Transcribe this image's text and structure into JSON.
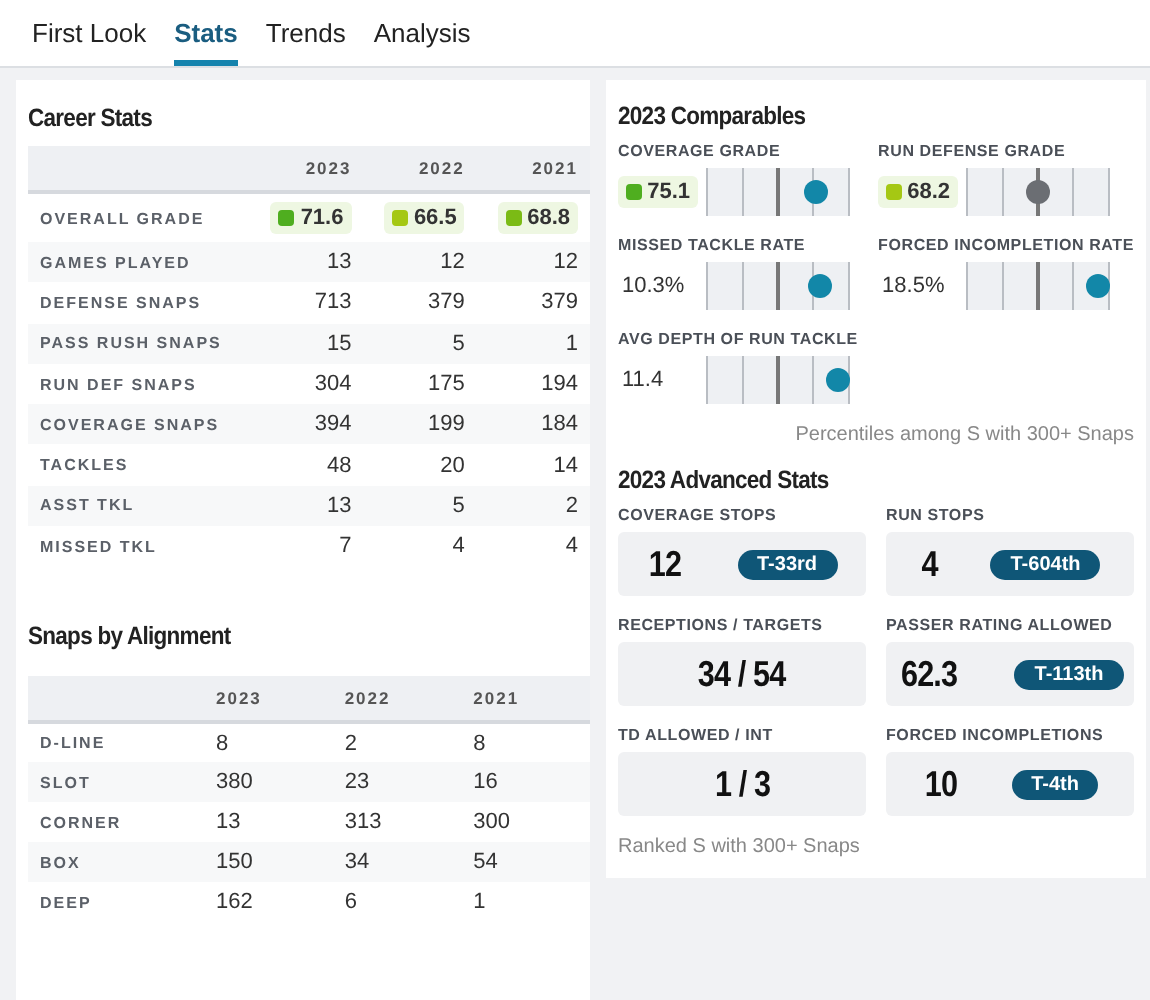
{
  "tabs": [
    {
      "label": "First Look",
      "selected": false
    },
    {
      "label": "Stats",
      "selected": true
    },
    {
      "label": "Trends",
      "selected": false
    },
    {
      "label": "Analysis",
      "selected": false
    }
  ],
  "career_stats": {
    "title": "Career Stats",
    "columns": [
      "2023",
      "2022",
      "2021"
    ],
    "rows": [
      {
        "label": "OVERALL GRADE",
        "kind": "grade",
        "cells": [
          {
            "value": "71.6",
            "color": "#4fae1f"
          },
          {
            "value": "66.5",
            "color": "#a5c813"
          },
          {
            "value": "68.8",
            "color": "#7bbb15"
          }
        ]
      },
      {
        "label": "GAMES PLAYED",
        "kind": "plain",
        "cells": [
          {
            "value": "13"
          },
          {
            "value": "12"
          },
          {
            "value": "12"
          }
        ]
      },
      {
        "label": "DEFENSE SNAPS",
        "kind": "plain",
        "cells": [
          {
            "value": "713"
          },
          {
            "value": "379"
          },
          {
            "value": "379"
          }
        ]
      },
      {
        "label": "PASS RUSH SNAPS",
        "kind": "plain",
        "cells": [
          {
            "value": "15"
          },
          {
            "value": "5"
          },
          {
            "value": "1"
          }
        ]
      },
      {
        "label": "RUN DEF SNAPS",
        "kind": "plain",
        "cells": [
          {
            "value": "304"
          },
          {
            "value": "175"
          },
          {
            "value": "194"
          }
        ]
      },
      {
        "label": "COVERAGE SNAPS",
        "kind": "plain",
        "cells": [
          {
            "value": "394"
          },
          {
            "value": "199"
          },
          {
            "value": "184"
          }
        ]
      },
      {
        "label": "TACKLES",
        "kind": "plain",
        "cells": [
          {
            "value": "48"
          },
          {
            "value": "20"
          },
          {
            "value": "14"
          }
        ]
      },
      {
        "label": "ASST TKL",
        "kind": "plain",
        "cells": [
          {
            "value": "13"
          },
          {
            "value": "5"
          },
          {
            "value": "2"
          }
        ]
      },
      {
        "label": "MISSED TKL",
        "kind": "plain",
        "cells": [
          {
            "value": "7"
          },
          {
            "value": "4"
          },
          {
            "value": "4"
          }
        ]
      }
    ]
  },
  "snaps_by_alignment": {
    "title": "Snaps by Alignment",
    "columns": [
      "2023",
      "2022",
      "2021"
    ],
    "rows": [
      {
        "label": "D-LINE",
        "cells": [
          "8",
          "2",
          "8"
        ]
      },
      {
        "label": "SLOT",
        "cells": [
          "380",
          "23",
          "16"
        ]
      },
      {
        "label": "CORNER",
        "cells": [
          "13",
          "313",
          "300"
        ]
      },
      {
        "label": "BOX",
        "cells": [
          "150",
          "34",
          "54"
        ]
      },
      {
        "label": "DEEP",
        "cells": [
          "162",
          "6",
          "1"
        ]
      }
    ]
  },
  "comparables": {
    "title": "2023 Comparables",
    "items": [
      {
        "label": "COVERAGE GRADE",
        "kind": "grade",
        "grade": {
          "value": "75.1",
          "color": "#4fae1f"
        },
        "level": 0.76,
        "color": "#1287a8"
      },
      {
        "label": "RUN DEFENSE GRADE",
        "kind": "grade",
        "grade": {
          "value": "68.2",
          "color": "#a5c813"
        },
        "level": 0.5,
        "color": "#6b6e73"
      },
      {
        "label": "MISSED TACKLE RATE",
        "kind": "value",
        "value": "10.3%",
        "level": 0.79,
        "color": "#1287a8"
      },
      {
        "label": "FORCED INCOMPLETION RATE",
        "kind": "value",
        "value": "18.5%",
        "level": 0.92,
        "color": "#1287a8"
      },
      {
        "label": "AVG DEPTH OF RUN TACKLE",
        "kind": "value",
        "value": "11.4",
        "level": 0.92,
        "color": "#1287a8"
      }
    ],
    "note": "Percentiles among S with 300+ Snaps"
  },
  "advanced": {
    "title": "2023 Advanced Stats",
    "items": [
      {
        "label": "COVERAGE STOPS",
        "value": "12",
        "rank": "T-33rd"
      },
      {
        "label": "RUN STOPS",
        "value": "4",
        "rank": "T-604th"
      },
      {
        "label": "RECEPTIONS / TARGETS",
        "value": "34 / 54"
      },
      {
        "label": "PASSER RATING ALLOWED",
        "value": "62.3",
        "rank": "T-113th"
      },
      {
        "label": "TD ALLOWED / INT",
        "value": "1 / 3"
      },
      {
        "label": "FORCED INCOMPLETIONS",
        "value": "10",
        "rank": "T-4th"
      }
    ],
    "note": "Ranked S with 300+ Snaps"
  }
}
